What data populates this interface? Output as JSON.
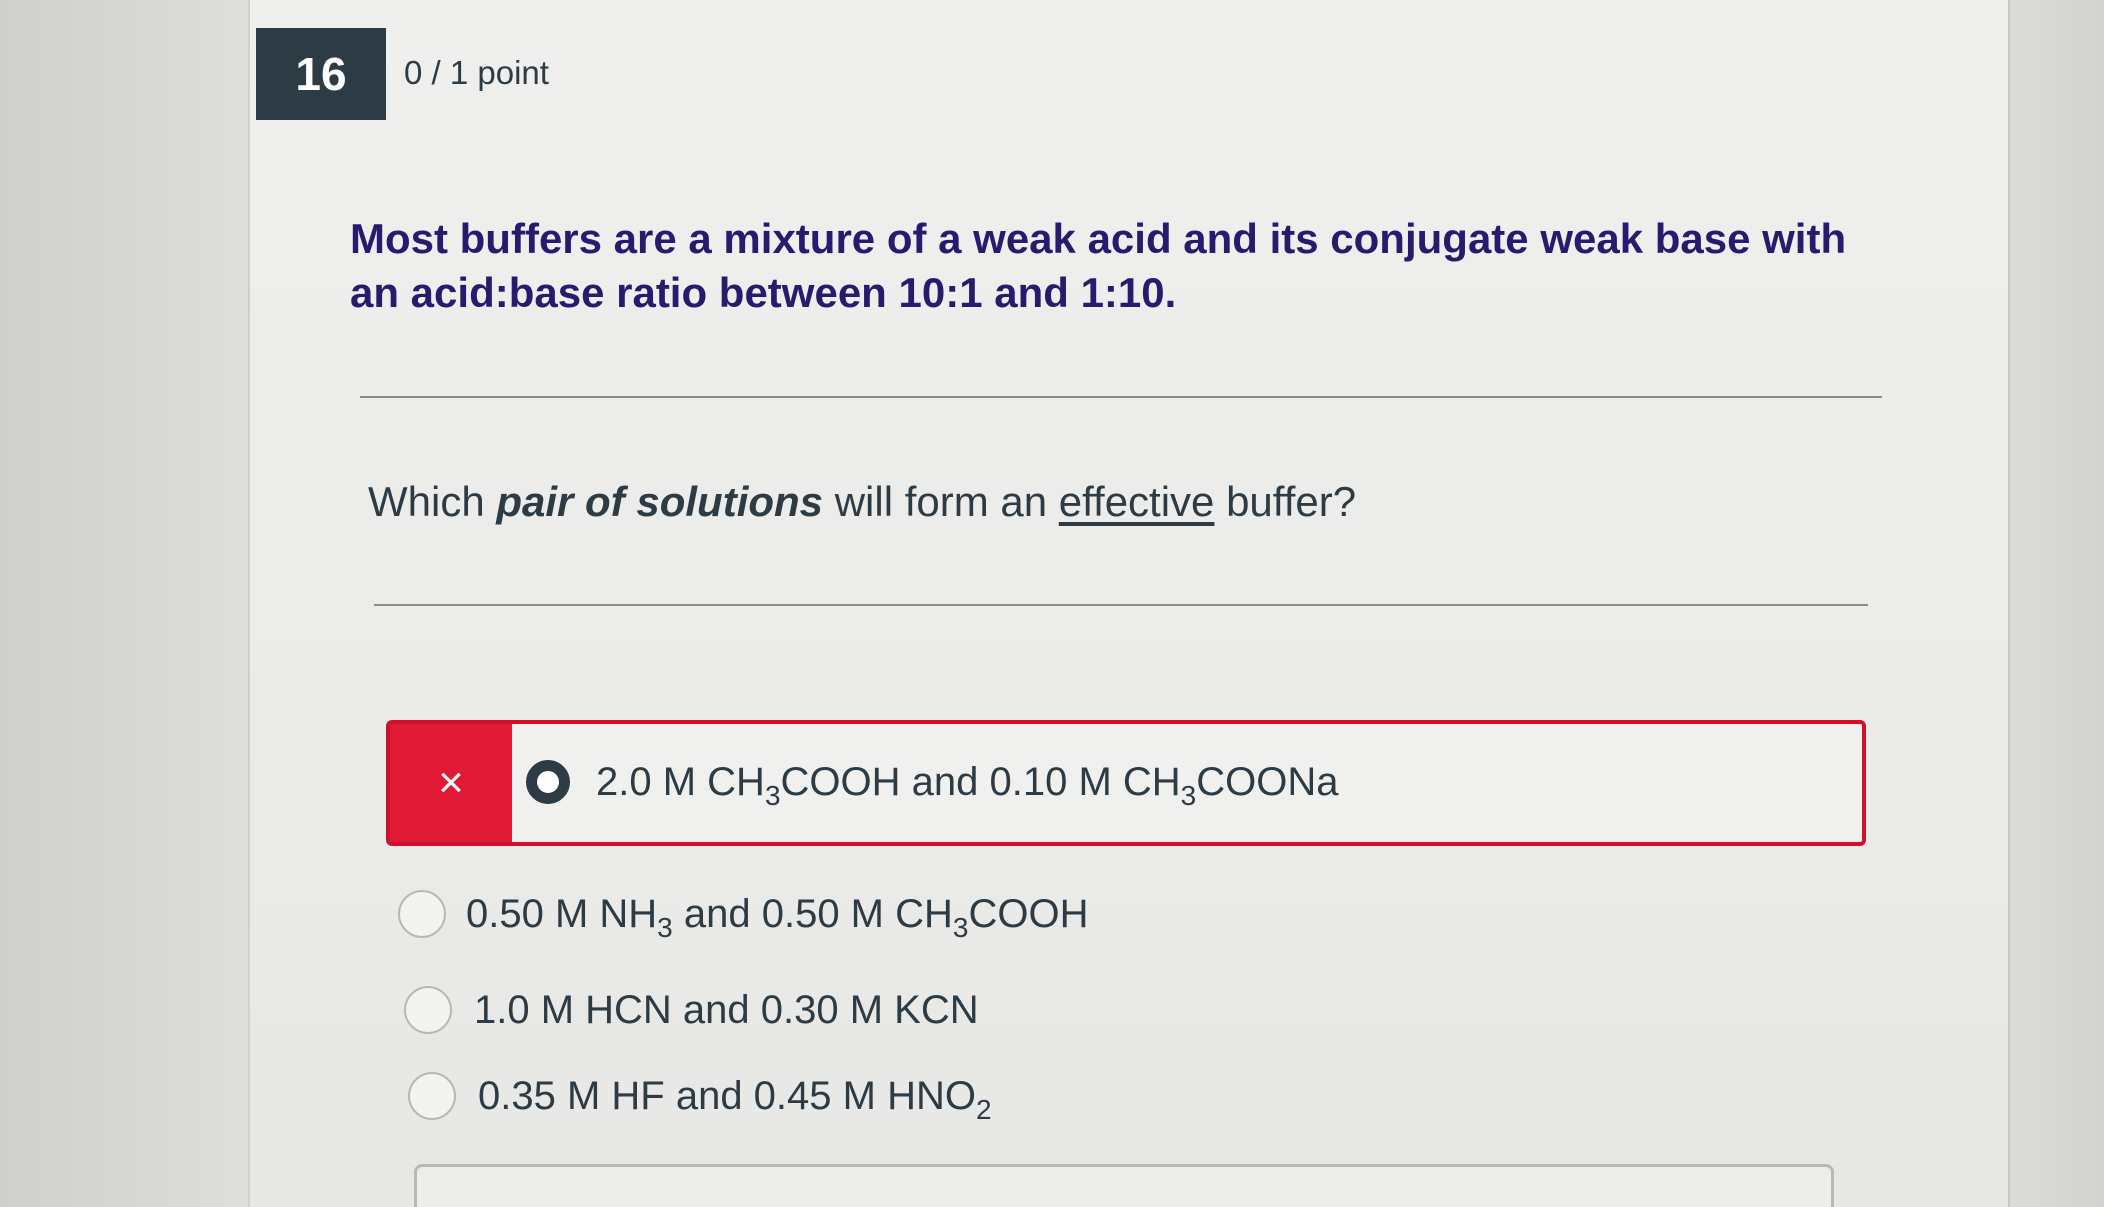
{
  "question": {
    "number": "16",
    "points": "0 / 1 point",
    "stem": "Most buffers are a mixture of a weak acid and its conjugate weak base with an acid:base ratio between 10:1 and 1:10.",
    "prompt": {
      "before": "Which ",
      "emphasis": "pair of solutions",
      "middle": " will form an ",
      "underlined": "effective",
      "after": " buffer?"
    }
  },
  "answers": [
    {
      "selected": true,
      "correct": false,
      "wrong_marker": "×",
      "parts": [
        "2.0 M CH",
        "3",
        "COOH and 0.10 M CH",
        "3",
        "COONa"
      ]
    },
    {
      "selected": false,
      "parts": [
        "0.50 M NH",
        "3",
        " and 0.50 M CH",
        "3",
        "COOH"
      ]
    },
    {
      "selected": false,
      "parts": [
        "1.0 M HCN and 0.30 M KCN"
      ]
    },
    {
      "selected": false,
      "parts": [
        "0.35 M HF and 0.45 M HNO",
        "2"
      ]
    }
  ],
  "colors": {
    "question_number_bg": "#2d3b45",
    "stem_text": "#2a1a6e",
    "incorrect_red": "#d0112b",
    "incorrect_flag": "#e01a35"
  }
}
